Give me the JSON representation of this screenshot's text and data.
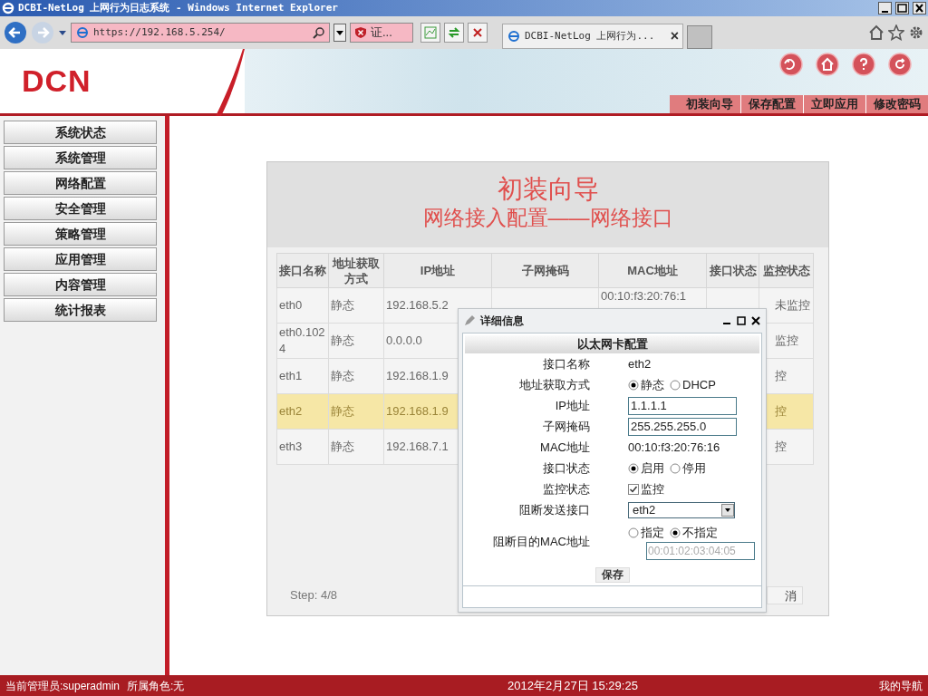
{
  "window": {
    "title": "DCBI-NetLog 上网行为日志系统 - Windows Internet Explorer"
  },
  "browser": {
    "address": "https://192.168.5.254/",
    "certificate": "证...",
    "tab": "DCBI-NetLog 上网行为...",
    "tab_close": "×"
  },
  "header": {
    "logo": "DCN",
    "actions": [
      "初装向导",
      "保存配置",
      "立即应用",
      "修改密码"
    ]
  },
  "sidebar": {
    "items": [
      "系统状态",
      "系统管理",
      "网络配置",
      "安全管理",
      "策略管理",
      "应用管理",
      "内容管理",
      "统计报表"
    ]
  },
  "wizard": {
    "title": "初装向导",
    "subtitle": "网络接入配置——网络接口",
    "step": "Step: 4/8",
    "cancel": "消",
    "table": {
      "columns": [
        "接口名称",
        "地址获取方式",
        "IP地址",
        "子网掩码",
        "MAC地址",
        "接口状态",
        "监控状态"
      ],
      "rows": [
        {
          "selected": false,
          "cells": [
            "eth0",
            "静态",
            "192.168.5.2",
            "",
            "00:10:f3:20:76:1",
            "",
            "未监控"
          ]
        },
        {
          "selected": false,
          "cells": [
            "eth0.1024",
            "静态",
            "0.0.0.0",
            "",
            "",
            "",
            "监控"
          ]
        },
        {
          "selected": false,
          "cells": [
            "eth1",
            "静态",
            "192.168.1.9",
            "",
            "",
            "",
            "控"
          ]
        },
        {
          "selected": true,
          "cells": [
            "eth2",
            "静态",
            "192.168.1.9",
            "",
            "",
            "",
            "控"
          ]
        },
        {
          "selected": false,
          "cells": [
            "eth3",
            "静态",
            "192.168.7.1",
            "",
            "",
            "",
            "控"
          ]
        }
      ]
    }
  },
  "dialog": {
    "title": "详细信息",
    "section": "以太网卡配置",
    "save": "保存",
    "fields": [
      {
        "kind": "text",
        "label": "接口名称",
        "value": "eth2"
      },
      {
        "kind": "radio",
        "label": "地址获取方式",
        "options": [
          {
            "label": "静态",
            "selected": true
          },
          {
            "label": "DHCP",
            "selected": false
          }
        ]
      },
      {
        "kind": "input",
        "label": "IP地址",
        "value": "1.1.1.1"
      },
      {
        "kind": "input",
        "label": "子网掩码",
        "value": "255.255.255.0"
      },
      {
        "kind": "text",
        "label": "MAC地址",
        "value": "00:10:f3:20:76:16"
      },
      {
        "kind": "radio",
        "label": "接口状态",
        "options": [
          {
            "label": "启用",
            "selected": true
          },
          {
            "label": "停用",
            "selected": false
          }
        ]
      },
      {
        "kind": "checkbox",
        "label": "监控状态",
        "option": "监控",
        "checked": true
      },
      {
        "kind": "select",
        "label": "阻断发送接口",
        "value": "eth2"
      },
      {
        "kind": "mac",
        "label": "阻断目的MAC地址",
        "options": [
          {
            "label": "指定",
            "selected": false
          },
          {
            "label": "不指定",
            "selected": true
          }
        ],
        "placeholder": "00:01:02:03:04:05"
      }
    ]
  },
  "status_bar": {
    "admin": "当前管理员:superadmin",
    "role": "所属角色:无",
    "time": "2012年2月27日 15:29:25",
    "nav": "我的导航"
  }
}
